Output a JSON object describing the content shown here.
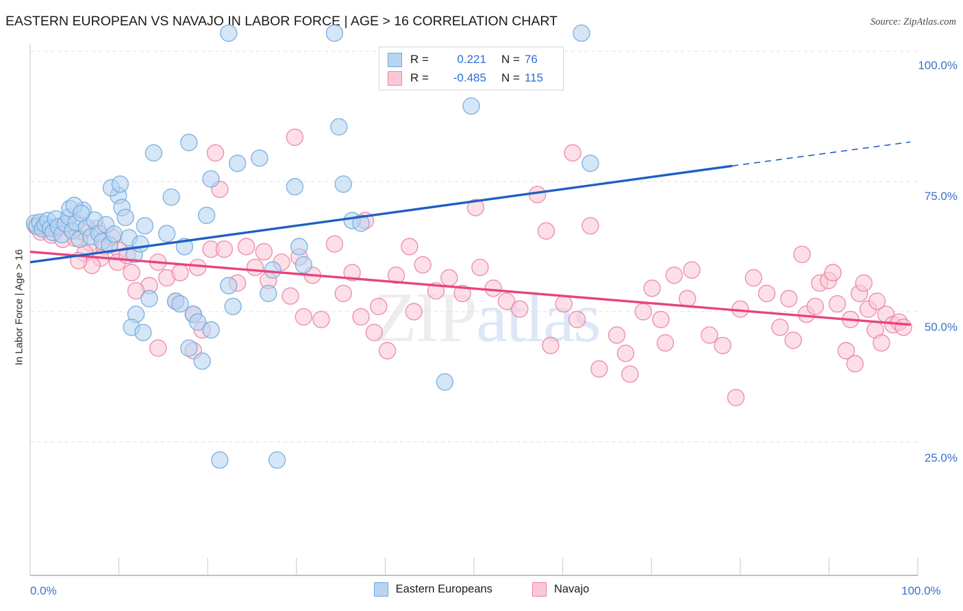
{
  "header": {
    "title": "EASTERN EUROPEAN VS NAVAJO IN LABOR FORCE | AGE > 16 CORRELATION CHART",
    "source": "Source: ZipAtlas.com"
  },
  "watermark": {
    "part1": "ZIP",
    "part2": "atlas"
  },
  "legend_stats": {
    "rows": [
      {
        "series": "Eastern Europeans",
        "r_label": "R =",
        "r_value": "0.221",
        "n_label": "N =",
        "n_value": "76",
        "color": "#b7d4f2",
        "border": "#6fa8dc"
      },
      {
        "series": "Navajo",
        "r_label": "R =",
        "r_value": "-0.485",
        "n_label": "N =",
        "n_value": "115",
        "color": "#fbc8d7",
        "border": "#ea7f9e"
      }
    ]
  },
  "bottom_legend": {
    "items": [
      {
        "label": "Eastern Europeans",
        "color": "#b7d4f2",
        "border": "#6fa8dc"
      },
      {
        "label": "Navajo",
        "color": "#fbc8d7",
        "border": "#ea7f9e"
      }
    ]
  },
  "axes": {
    "y_label": "In Labor Force | Age > 16",
    "y_ticks": [
      "100.0%",
      "75.0%",
      "50.0%",
      "25.0%"
    ],
    "x_ticks": [
      "0.0%",
      "100.0%"
    ]
  },
  "chart_data": {
    "type": "scatter",
    "title": "EASTERN EUROPEAN VS NAVAJO IN LABOR FORCE | AGE > 16 CORRELATION CHART",
    "xlabel": "",
    "ylabel": "In Labor Force | Age > 16",
    "xlim": [
      0,
      100
    ],
    "ylim": [
      0,
      110
    ],
    "x_tick_values": [
      0,
      100
    ],
    "y_tick_values": [
      25,
      50,
      75,
      100
    ],
    "grid": "horizontal-dashed",
    "legend_position": "top-center",
    "colors": {
      "series1_fill": "#b7d4f2",
      "series1_stroke": "#6fa8dc",
      "series2_fill": "#fbc8d7",
      "series2_stroke": "#ea7f9e",
      "trend1": "#1f5fc4",
      "trend2": "#e8447c",
      "tick_text": "#3a72c8"
    },
    "series": [
      {
        "name": "Eastern Europeans",
        "r": 0.221,
        "n": 76,
        "fill": "#b7d4f2",
        "stroke": "#6fa8dc",
        "trendline": {
          "x0": 0,
          "y0": 59.5,
          "x1": 79.6,
          "y1": 78.0,
          "dashed_from_x": 79.6,
          "dashed_to_x": 99.8,
          "dashed_to_y": 82.6
        },
        "points": [
          [
            0.5,
            67.0
          ],
          [
            0.8,
            66.4
          ],
          [
            1.1,
            67.2
          ],
          [
            1.4,
            65.9
          ],
          [
            1.7,
            66.8
          ],
          [
            2.0,
            67.5
          ],
          [
            2.3,
            66.0
          ],
          [
            2.6,
            65.2
          ],
          [
            2.9,
            67.8
          ],
          [
            3.2,
            66.3
          ],
          [
            3.6,
            64.8
          ],
          [
            4.0,
            66.9
          ],
          [
            4.4,
            68.2
          ],
          [
            4.8,
            65.5
          ],
          [
            5.2,
            67.1
          ],
          [
            5.6,
            63.9
          ],
          [
            6.0,
            69.5
          ],
          [
            6.4,
            66.2
          ],
          [
            6.9,
            64.4
          ],
          [
            7.3,
            67.6
          ],
          [
            4.5,
            69.8
          ],
          [
            5.0,
            70.4
          ],
          [
            5.8,
            68.9
          ],
          [
            7.8,
            65.0
          ],
          [
            8.2,
            63.5
          ],
          [
            8.6,
            66.7
          ],
          [
            9.0,
            62.8
          ],
          [
            9.5,
            64.9
          ],
          [
            10.0,
            72.3
          ],
          [
            10.4,
            70.0
          ],
          [
            10.8,
            68.1
          ],
          [
            11.2,
            64.2
          ],
          [
            11.8,
            61.0
          ],
          [
            12.5,
            63.0
          ],
          [
            13.0,
            66.5
          ],
          [
            9.2,
            73.8
          ],
          [
            10.2,
            74.5
          ],
          [
            14.0,
            80.5
          ],
          [
            18.0,
            82.5
          ],
          [
            20.5,
            75.5
          ],
          [
            16.0,
            72.0
          ],
          [
            15.5,
            65.0
          ],
          [
            17.5,
            62.5
          ],
          [
            20.0,
            68.5
          ],
          [
            22.5,
            55.0
          ],
          [
            23.5,
            78.5
          ],
          [
            26.0,
            79.5
          ],
          [
            30.0,
            74.0
          ],
          [
            23.0,
            51.0
          ],
          [
            35.0,
            85.5
          ],
          [
            35.5,
            74.5
          ],
          [
            36.5,
            67.5
          ],
          [
            37.5,
            67.0
          ],
          [
            30.5,
            62.5
          ],
          [
            31.0,
            59.0
          ],
          [
            27.5,
            58.0
          ],
          [
            22.5,
            103.5
          ],
          [
            34.5,
            103.5
          ],
          [
            62.5,
            103.5
          ],
          [
            50.0,
            89.5
          ],
          [
            63.5,
            78.5
          ],
          [
            13.5,
            52.5
          ],
          [
            12.0,
            49.5
          ],
          [
            11.5,
            47.0
          ],
          [
            12.8,
            46.0
          ],
          [
            16.5,
            52.0
          ],
          [
            18.5,
            49.5
          ],
          [
            17.0,
            51.5
          ],
          [
            19.0,
            48.0
          ],
          [
            20.5,
            46.5
          ],
          [
            18.0,
            43.0
          ],
          [
            19.5,
            40.5
          ],
          [
            21.5,
            21.5
          ],
          [
            28.0,
            21.5
          ],
          [
            47.0,
            36.5
          ],
          [
            27.0,
            53.5
          ]
        ]
      },
      {
        "name": "Navajo",
        "r": -0.485,
        "n": 115,
        "fill": "#fbc8d7",
        "stroke": "#ea7f9e",
        "trendline": {
          "x0": 0,
          "y0": 61.5,
          "x1": 99.8,
          "y1": 47.5
        },
        "points": [
          [
            0.6,
            66.5
          ],
          [
            1.2,
            65.3
          ],
          [
            1.8,
            66.1
          ],
          [
            2.4,
            64.7
          ],
          [
            3.0,
            65.8
          ],
          [
            3.7,
            63.9
          ],
          [
            4.3,
            66.3
          ],
          [
            5.1,
            64.1
          ],
          [
            5.9,
            65.4
          ],
          [
            6.8,
            63.2
          ],
          [
            7.6,
            66.0
          ],
          [
            8.4,
            62.5
          ],
          [
            9.3,
            64.3
          ],
          [
            10.1,
            61.8
          ],
          [
            8.0,
            60.3
          ],
          [
            6.2,
            61.2
          ],
          [
            9.9,
            59.5
          ],
          [
            11.0,
            60.8
          ],
          [
            7.0,
            58.9
          ],
          [
            5.5,
            59.8
          ],
          [
            11.5,
            57.5
          ],
          [
            13.5,
            55.0
          ],
          [
            12.0,
            54.0
          ],
          [
            14.5,
            59.5
          ],
          [
            15.5,
            56.5
          ],
          [
            17.0,
            57.5
          ],
          [
            19.0,
            58.5
          ],
          [
            20.5,
            62.0
          ],
          [
            21.5,
            73.5
          ],
          [
            16.5,
            52.0
          ],
          [
            18.5,
            49.5
          ],
          [
            19.5,
            46.5
          ],
          [
            14.5,
            43.0
          ],
          [
            18.5,
            42.5
          ],
          [
            22.0,
            62.0
          ],
          [
            23.5,
            55.5
          ],
          [
            25.5,
            58.5
          ],
          [
            27.0,
            56.0
          ],
          [
            28.5,
            59.5
          ],
          [
            24.5,
            62.5
          ],
          [
            26.5,
            61.5
          ],
          [
            29.5,
            53.0
          ],
          [
            31.0,
            49.0
          ],
          [
            33.0,
            48.5
          ],
          [
            30.5,
            60.5
          ],
          [
            32.0,
            57.0
          ],
          [
            34.5,
            63.0
          ],
          [
            36.5,
            57.5
          ],
          [
            38.0,
            67.5
          ],
          [
            30.0,
            83.5
          ],
          [
            21.0,
            80.5
          ],
          [
            35.5,
            53.5
          ],
          [
            37.5,
            49.0
          ],
          [
            39.0,
            46.0
          ],
          [
            40.5,
            42.5
          ],
          [
            41.5,
            57.0
          ],
          [
            43.0,
            62.5
          ],
          [
            44.5,
            59.0
          ],
          [
            46.0,
            54.0
          ],
          [
            47.5,
            56.5
          ],
          [
            49.0,
            53.5
          ],
          [
            43.5,
            50.0
          ],
          [
            39.5,
            51.0
          ],
          [
            51.0,
            58.5
          ],
          [
            52.5,
            54.5
          ],
          [
            54.0,
            52.0
          ],
          [
            55.5,
            50.5
          ],
          [
            50.5,
            70.0
          ],
          [
            58.5,
            65.5
          ],
          [
            61.5,
            80.5
          ],
          [
            63.5,
            66.5
          ],
          [
            57.5,
            72.5
          ],
          [
            60.5,
            51.5
          ],
          [
            62.0,
            48.5
          ],
          [
            59.0,
            43.5
          ],
          [
            64.5,
            39.0
          ],
          [
            66.5,
            45.5
          ],
          [
            67.5,
            42.0
          ],
          [
            69.5,
            50.0
          ],
          [
            70.5,
            54.5
          ],
          [
            71.5,
            48.5
          ],
          [
            73.0,
            57.0
          ],
          [
            75.0,
            58.0
          ],
          [
            68.0,
            38.0
          ],
          [
            72.0,
            44.0
          ],
          [
            74.5,
            52.5
          ],
          [
            77.0,
            45.5
          ],
          [
            78.5,
            43.5
          ],
          [
            80.5,
            50.5
          ],
          [
            82.0,
            56.5
          ],
          [
            83.5,
            53.5
          ],
          [
            80.0,
            33.5
          ],
          [
            85.0,
            47.0
          ],
          [
            86.5,
            44.5
          ],
          [
            88.0,
            49.5
          ],
          [
            89.5,
            55.5
          ],
          [
            90.5,
            56.0
          ],
          [
            87.5,
            61.0
          ],
          [
            91.5,
            51.5
          ],
          [
            93.0,
            48.5
          ],
          [
            94.0,
            53.5
          ],
          [
            95.0,
            50.5
          ],
          [
            95.8,
            46.5
          ],
          [
            96.5,
            44.0
          ],
          [
            92.5,
            42.5
          ],
          [
            93.5,
            40.0
          ],
          [
            97.0,
            49.5
          ],
          [
            97.8,
            47.5
          ],
          [
            98.5,
            48.0
          ],
          [
            99.0,
            47.0
          ],
          [
            96.0,
            52.0
          ],
          [
            94.5,
            55.5
          ],
          [
            91.0,
            57.5
          ],
          [
            89.0,
            51.0
          ],
          [
            86.0,
            52.5
          ]
        ]
      }
    ]
  }
}
